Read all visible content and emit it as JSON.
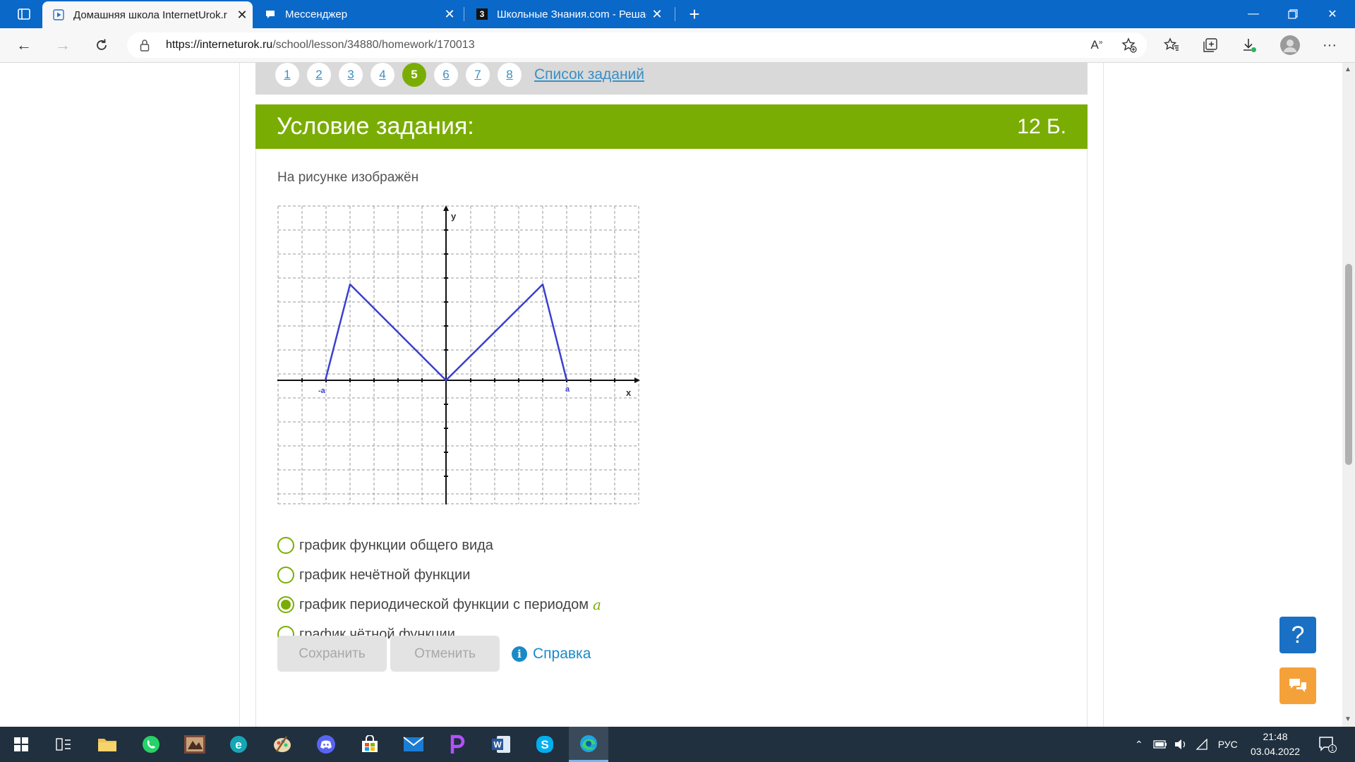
{
  "browser": {
    "tabs": [
      {
        "title": "Домашняя школа InternetUrok.r",
        "active": true,
        "icon": "play-icon"
      },
      {
        "title": "Мессенджер",
        "active": false,
        "icon": "messenger-icon"
      },
      {
        "title": "Школьные Знания.com - Решае",
        "active": false,
        "icon": "znania-icon"
      }
    ],
    "znania_favicon_letter": "3",
    "url_host": "https://interneturok.ru",
    "url_path": "/school/lesson/34880/homework/170013"
  },
  "task_nav": {
    "numbers": [
      "1",
      "2",
      "3",
      "4",
      "5",
      "6",
      "7",
      "8"
    ],
    "current": "5",
    "list_label": "Список заданий"
  },
  "task": {
    "header": "Условие задания:",
    "points": "12 Б.",
    "text": "На рисунке изображён",
    "graph_labels": {
      "y": "y",
      "x": "x",
      "neg_a": "-a",
      "pos_a": "a"
    },
    "options": [
      {
        "label": "график функции общего вида",
        "checked": false
      },
      {
        "label": "график нечётной функции",
        "checked": false
      },
      {
        "label": "график периодической функции с периодом",
        "checked": true,
        "math": "a"
      },
      {
        "label": "график чётной функции",
        "checked": false
      }
    ],
    "save_label": "Сохранить",
    "cancel_label": "Отменить",
    "help_label": "Справка",
    "help_icon_glyph": "i"
  },
  "float_buttons": {
    "help_glyph": "?"
  },
  "taskbar": {
    "lang": "РУС",
    "time": "21:48",
    "date": "03.04.2022",
    "notification_count": "1"
  },
  "colors": {
    "accent_green": "#7aad04",
    "link_blue": "#3a8fc5",
    "help_blue": "#1a70c4",
    "chat_orange": "#f5a13a",
    "browser_blue": "#0a68c9",
    "graph_line": "#3a3fd0"
  }
}
